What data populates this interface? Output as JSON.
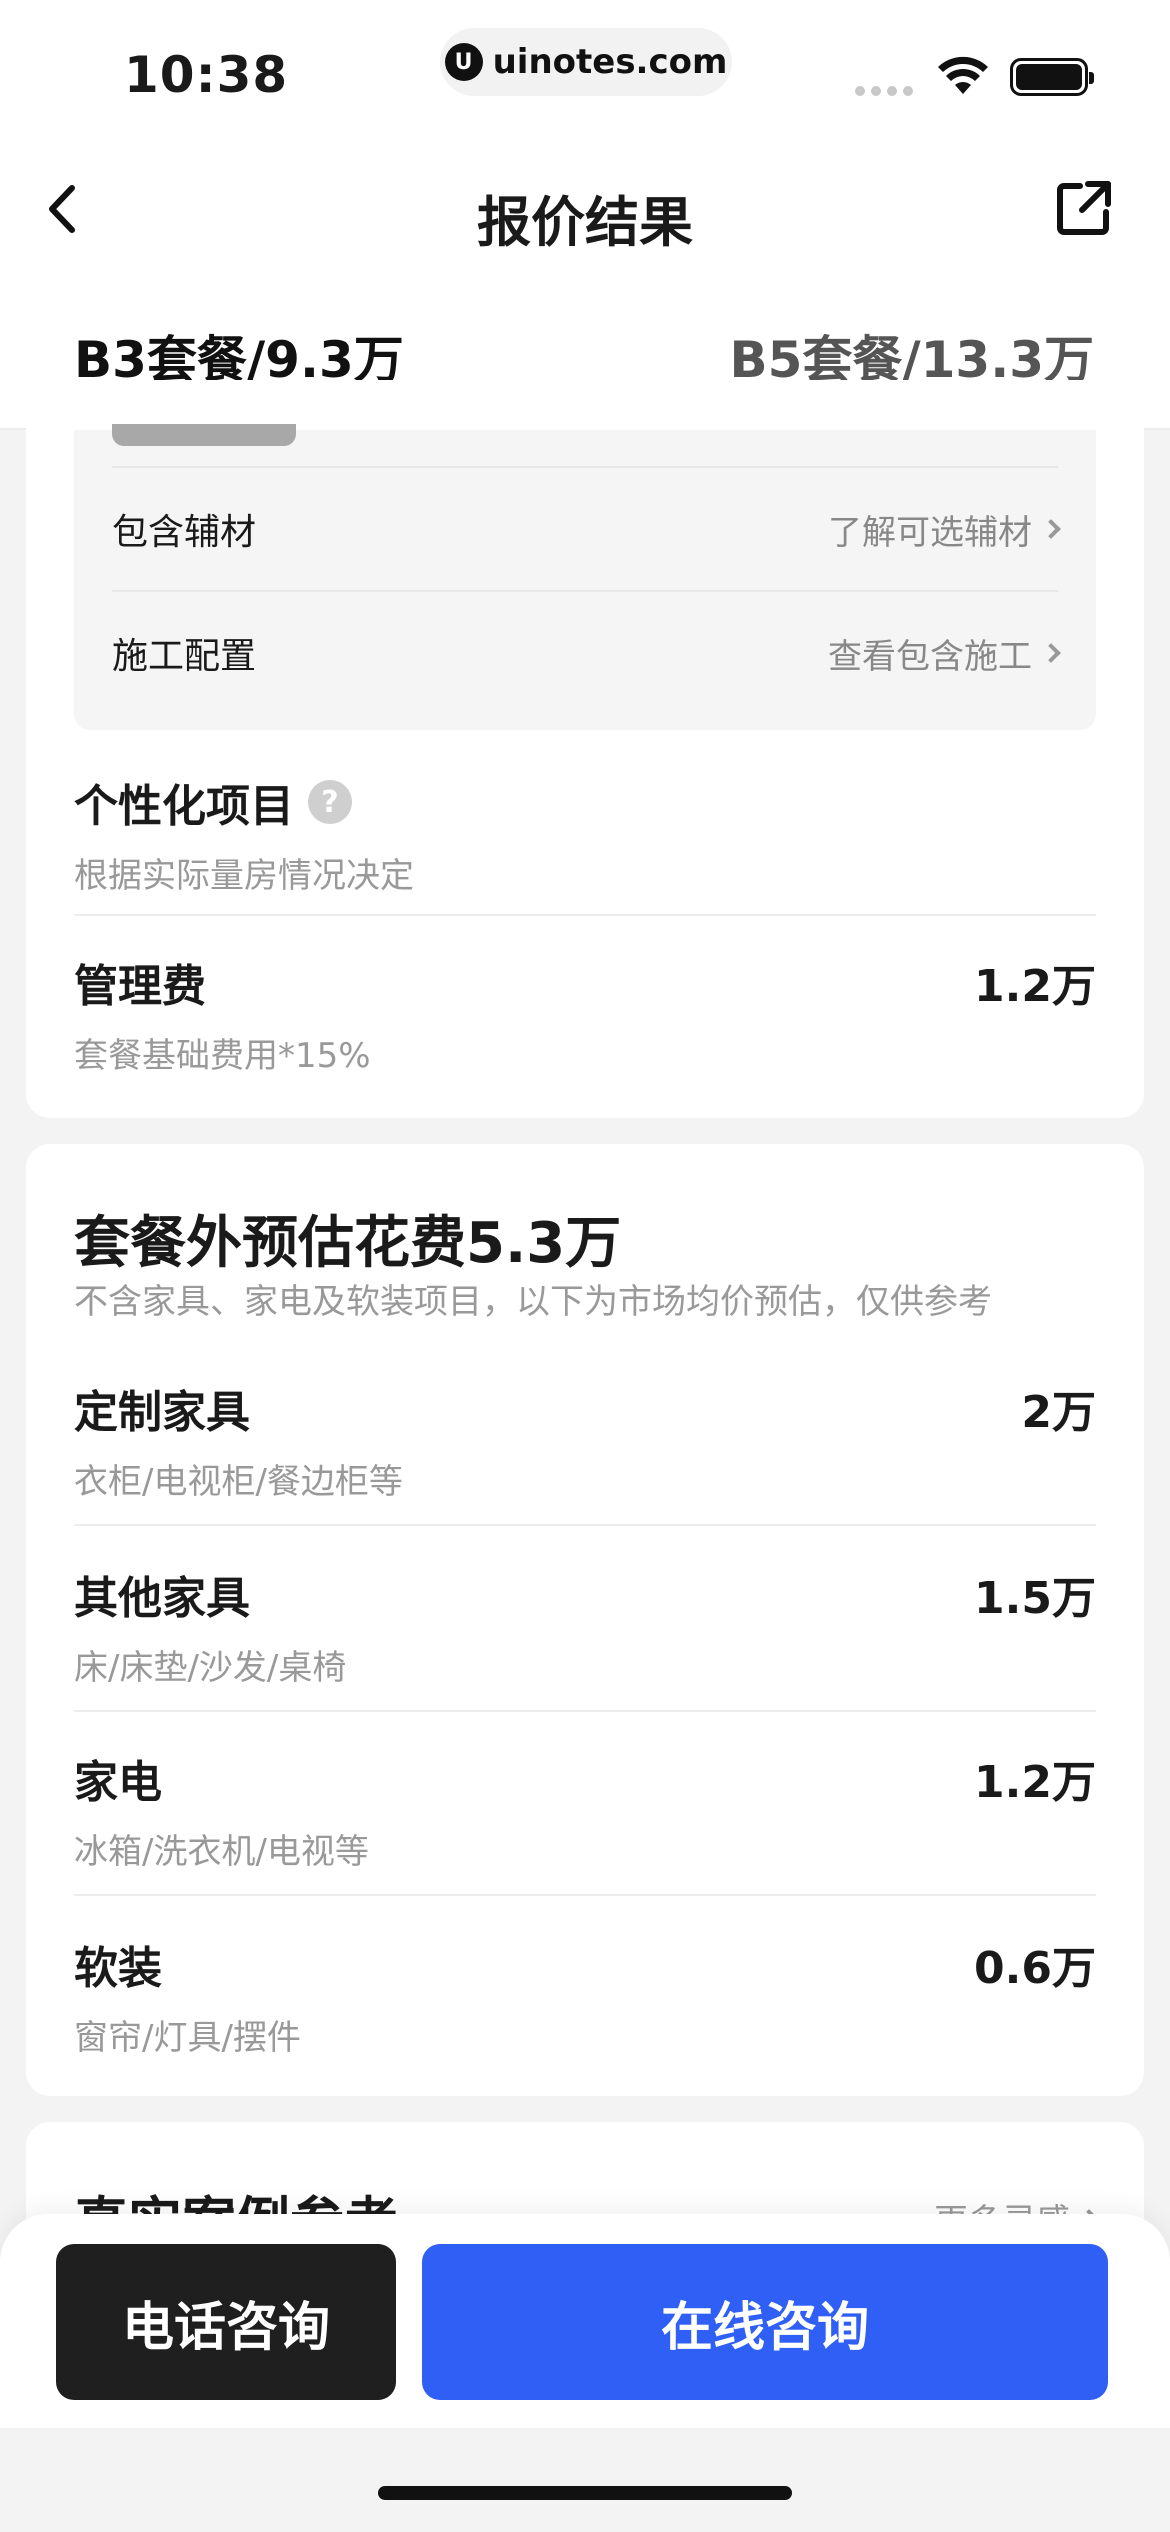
{
  "status_bar": {
    "time": "10:38",
    "url": "uinotes.com",
    "logo_glyph": "U"
  },
  "nav": {
    "title": "报价结果"
  },
  "tabs": [
    {
      "label": "B3套餐/9.3万"
    },
    {
      "label": "B5套餐/13.3万"
    }
  ],
  "included": {
    "rows": [
      {
        "label": "包含辅材",
        "link": "了解可选辅材"
      },
      {
        "label": "施工配置",
        "link": "查看包含施工"
      }
    ]
  },
  "custom_items": {
    "title": "个性化项目",
    "help_glyph": "?",
    "subtitle": "根据实际量房情况决定"
  },
  "management_fee": {
    "title": "管理费",
    "subtitle": "套餐基础费用*15%",
    "value": "1.2万"
  },
  "extra_costs": {
    "title": "套餐外预估花费5.3万",
    "subtitle": "不含家具、家电及软装项目，以下为市场均价预估，仅供参考",
    "items": [
      {
        "title": "定制家具",
        "subtitle": "衣柜/电视柜/餐边柜等",
        "value": "2万"
      },
      {
        "title": "其他家具",
        "subtitle": "床/床垫/沙发/桌椅",
        "value": "1.5万"
      },
      {
        "title": "家电",
        "subtitle": "冰箱/洗衣机/电视等",
        "value": "1.2万"
      },
      {
        "title": "软装",
        "subtitle": "窗帘/灯具/摆件",
        "value": "0.6万"
      }
    ]
  },
  "cases": {
    "title": "真实案例参考",
    "more": "更多灵感"
  },
  "bottom": {
    "phone_label": "电话咨询",
    "online_label": "在线咨询"
  },
  "colors": {
    "accent": "#2f5ff5",
    "dark_button": "#1f1f1f",
    "muted_text": "#999999"
  }
}
